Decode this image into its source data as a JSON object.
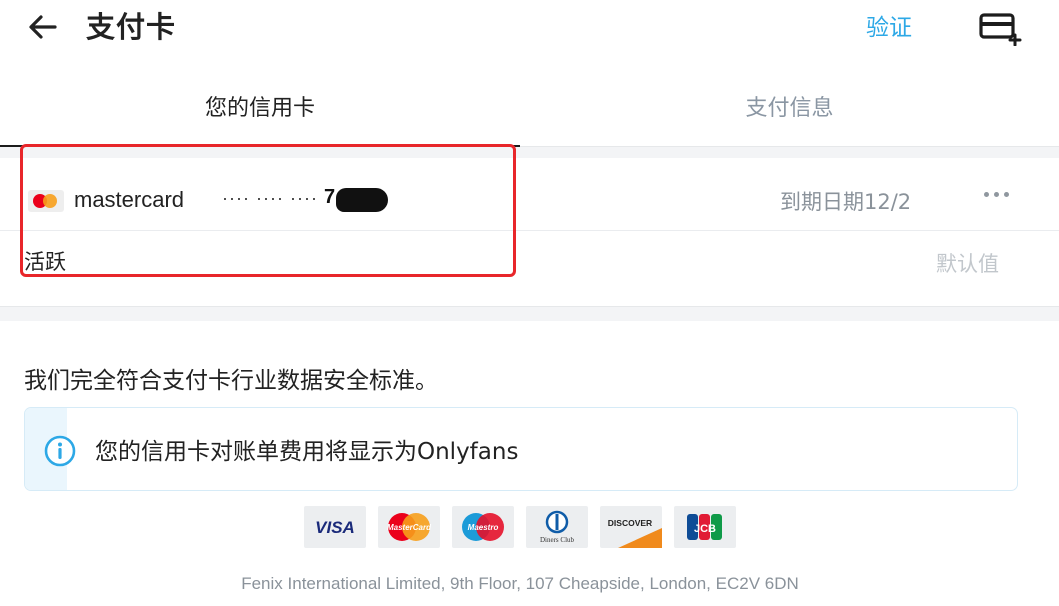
{
  "header": {
    "back_icon": "arrow-left-icon",
    "title": "支付卡",
    "verify_label": "验证",
    "add_card_icon": "add-card-icon"
  },
  "tabs": [
    {
      "label": "您的信用卡",
      "active": true
    },
    {
      "label": "支付信息",
      "active": false
    }
  ],
  "card": {
    "brand": "mastercard",
    "number_masked": "···· ···· ····",
    "last_digits": "7",
    "expiry": "到期日期12/2",
    "status": "活跃",
    "default_label": "默认值",
    "more_icon": "more-horizontal-icon"
  },
  "security_note": "我们完全符合支付卡行业数据安全标准。",
  "info": {
    "icon": "info-icon",
    "text": "您的信用卡对账单费用将显示为Onlyfans"
  },
  "payment_logos": [
    {
      "name": "visa-logo",
      "label": "VISA"
    },
    {
      "name": "mastercard-logo",
      "label": "MasterCard"
    },
    {
      "name": "maestro-logo",
      "label": "Maestro"
    },
    {
      "name": "diners-club-logo",
      "label": "Diners Club"
    },
    {
      "name": "discover-logo",
      "label": "DISCOVER"
    },
    {
      "name": "jcb-logo",
      "label": "JCB"
    }
  ],
  "footer": "Fenix International Limited, 9th Floor, 107 Cheapside, London, EC2V 6DN",
  "colors": {
    "accent": "#2da8e6",
    "highlight": "#e8262a",
    "muted": "#8a929a"
  }
}
